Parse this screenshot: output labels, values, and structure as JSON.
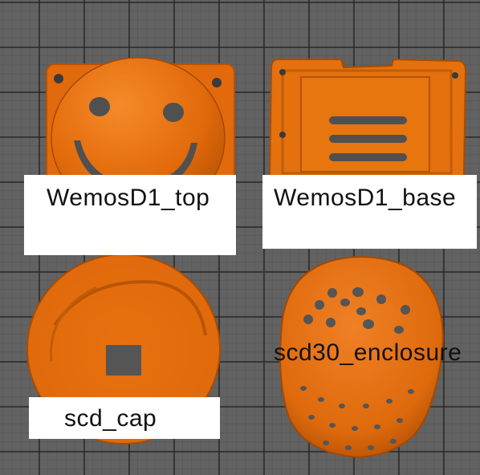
{
  "scene": {
    "description_color_part": "#e56f0f",
    "background": "#626262"
  },
  "labels": {
    "wemos_top": "WemosD1_top",
    "wemos_base": "WemosD1_base",
    "scd_cap": "scd_cap",
    "scd30_enclosure": "scd30_enclosure"
  }
}
